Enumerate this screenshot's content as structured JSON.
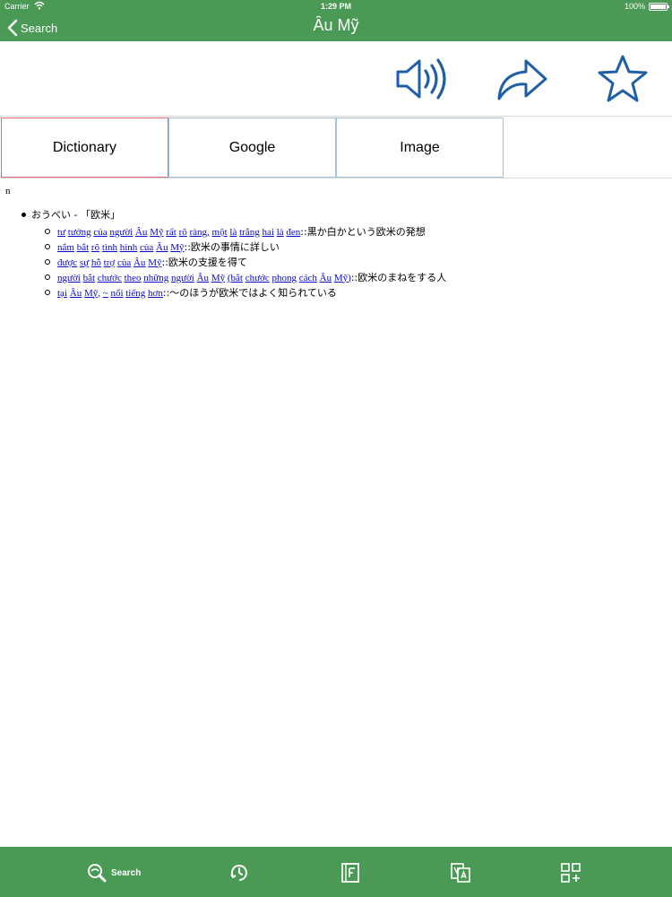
{
  "status_bar": {
    "carrier": "Carrier",
    "time": "1:29 PM",
    "battery": "100%"
  },
  "nav": {
    "back_label": "Search",
    "title": "Âu Mỹ"
  },
  "toolbar": {
    "icons": [
      "speaker-icon",
      "share-icon",
      "star-icon"
    ]
  },
  "tabs": [
    {
      "label": "Dictionary",
      "active": true
    },
    {
      "label": "Google",
      "active": false
    },
    {
      "label": "Image",
      "active": false
    }
  ],
  "content": {
    "part_of_speech": "n",
    "entry": "おうべい - 「欧米」",
    "examples": [
      {
        "vi": [
          "tư",
          "tưởng",
          "của",
          "người",
          "Âu",
          "Mỹ",
          "rất",
          "rõ",
          "ràng,",
          "một",
          "là",
          "trắng",
          "hai",
          "là",
          "đen"
        ],
        "jp": "::黒か白かという欧米の発想"
      },
      {
        "vi": [
          "nắm",
          "bắt",
          "rõ",
          "tình",
          "hình",
          "của",
          "Âu",
          "Mỹ"
        ],
        "jp": "::欧米の事情に詳しい"
      },
      {
        "vi": [
          "được",
          "sự",
          "hỗ",
          "trợ",
          "của",
          "Âu",
          "Mỹ"
        ],
        "jp": "::欧米の支援を得て"
      },
      {
        "vi": [
          "người",
          "bắt",
          "chước",
          "theo",
          "những",
          "người",
          "Âu",
          "Mỹ",
          "(bắt",
          "chước",
          "phong",
          "cách",
          "Âu",
          "Mỹ)"
        ],
        "jp": "::欧米のまねをする人"
      },
      {
        "vi": [
          "tại",
          "Âu",
          "Mỹ,",
          "~",
          "nổi",
          "tiếng",
          "hơn"
        ],
        "jp": "::～のほうが欧米ではよく知られている"
      }
    ]
  },
  "tabbar": {
    "search_label": "Search"
  },
  "colors": {
    "brand_green": "#4a9a56",
    "icon_blue": "#1f5fa8",
    "link_blue": "#0a0ad0",
    "active_tab_border": "#e06b72",
    "tab_border": "#9fc5e8"
  }
}
